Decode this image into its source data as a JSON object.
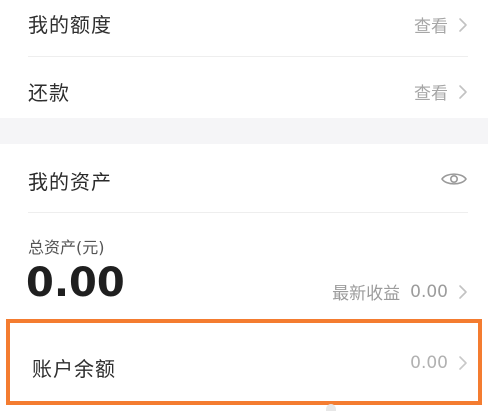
{
  "rows": {
    "quota": {
      "title": "我的额度",
      "action": "查看"
    },
    "repay": {
      "title": "还款",
      "action": "查看"
    }
  },
  "assets": {
    "title": "我的资产",
    "total_label": "总资产(元)",
    "total_value": "0.00",
    "latest_label": "最新收益",
    "latest_value": "0.00"
  },
  "balance": {
    "title": "账户余额",
    "value": "0.00"
  },
  "icons": {
    "chevron": "chevron-right-icon",
    "eye": "eye-icon"
  },
  "colors": {
    "highlight_border": "#f47c30",
    "section_gap": "#f5f5f7",
    "muted_text": "#a6a6a6"
  }
}
